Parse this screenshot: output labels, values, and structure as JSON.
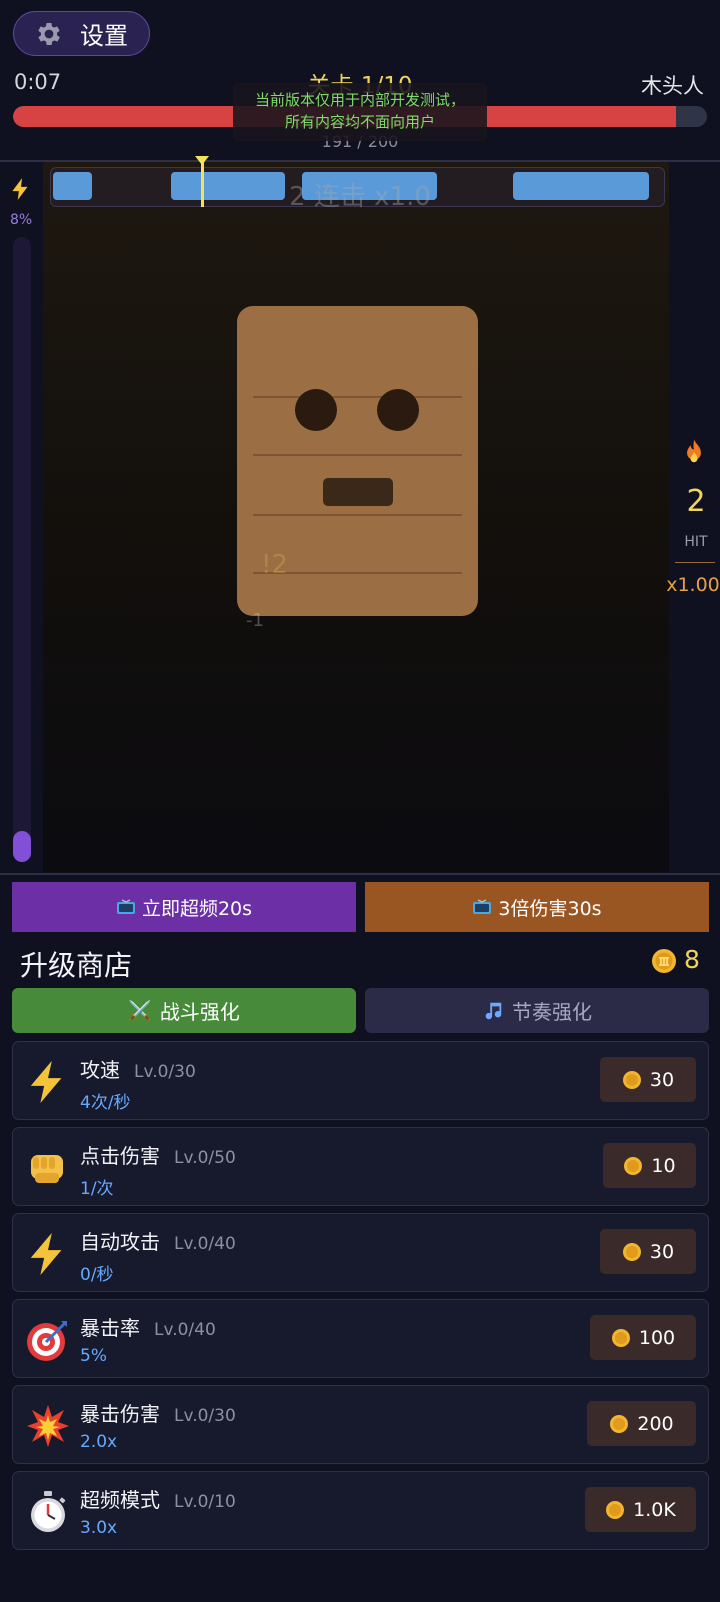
{
  "header": {
    "settings_label": "设置",
    "timer": "0:07",
    "level_title": "关卡 1/10",
    "enemy_name": "木头人",
    "hp_text": "191 / 200",
    "hp_fraction": 0.955
  },
  "dev_notice": {
    "line1": "当前版本仅用于内部开发测试，",
    "line2": "所有内容均不面向用户"
  },
  "battle": {
    "energy_percent": "8%",
    "energy_fraction": 0.08,
    "combo_label": "2 连击 x1.0",
    "float_damage": "!2",
    "float_minus": "-1",
    "hit_count": "2",
    "hit_label": "HIT",
    "multiplier": "x1.00"
  },
  "boosts": {
    "overclock_label": "立即超频20s",
    "damage_label": "3倍伤害30s"
  },
  "shop": {
    "title": "升级商店",
    "coins": "8",
    "tabs": [
      {
        "label": "战斗强化",
        "active": true
      },
      {
        "label": "节奏强化",
        "active": false
      }
    ],
    "items": [
      {
        "name": "攻速",
        "level": "Lv.0/30",
        "value": "4次/秒",
        "price": "30",
        "icon": "lightning-icon"
      },
      {
        "name": "点击伤害",
        "level": "Lv.0/50",
        "value": "1/次",
        "price": "10",
        "icon": "fist-icon"
      },
      {
        "name": "自动攻击",
        "level": "Lv.0/40",
        "value": "0/秒",
        "price": "30",
        "icon": "lightning-icon"
      },
      {
        "name": "暴击率",
        "level": "Lv.0/40",
        "value": "5%",
        "price": "100",
        "icon": "target-icon"
      },
      {
        "name": "暴击伤害",
        "level": "Lv.0/30",
        "value": "2.0x",
        "price": "200",
        "icon": "explosion-icon"
      },
      {
        "name": "超频模式",
        "level": "Lv.0/10",
        "value": "3.0x",
        "price": "1.0K",
        "icon": "stopwatch-icon"
      }
    ]
  },
  "colors": {
    "accent_purple": "#6c2fa6",
    "accent_orange": "#9a5622",
    "hp_red": "#d74343",
    "gold": "#f1d55a",
    "value_blue": "#66aaff"
  }
}
